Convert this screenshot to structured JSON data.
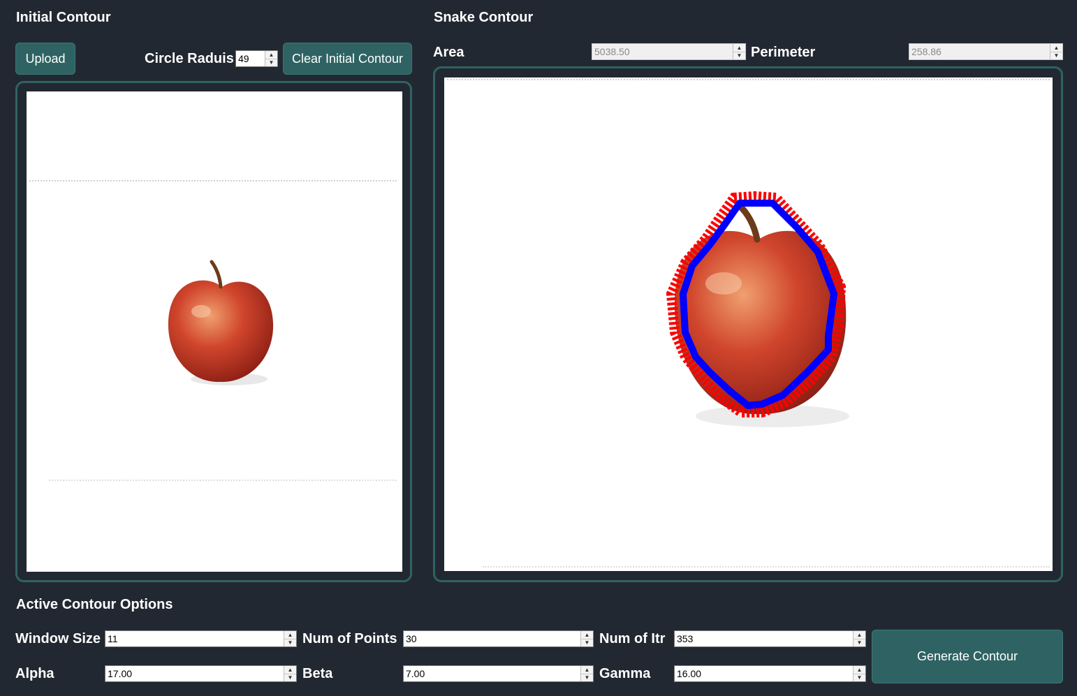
{
  "left": {
    "title": "Initial Contour",
    "upload_label": "Upload",
    "radius_label": "Circle Raduis",
    "radius_value": "49",
    "clear_label": "Clear Initial Contour"
  },
  "right": {
    "title": "Snake Contour",
    "area_label": "Area",
    "area_value": "5038.50",
    "perimeter_label": "Perimeter",
    "perimeter_value": "258.86"
  },
  "options": {
    "title": "Active Contour Options",
    "window_size_label": "Window Size",
    "window_size_value": "11",
    "num_points_label": "Num of Points",
    "num_points_value": "30",
    "num_itr_label": "Num of Itr",
    "num_itr_value": "353",
    "alpha_label": "Alpha",
    "alpha_value": "17.00",
    "beta_label": "Beta",
    "beta_value": "7.00",
    "gamma_label": "Gamma",
    "gamma_value": "16.00",
    "generate_label": "Generate Contour"
  },
  "colors": {
    "background": "#222831",
    "accent": "#2f6363",
    "snake_outer": "#ff0000",
    "snake_inner": "#0000ff",
    "apple": "#c0392b"
  },
  "icons": {
    "spin_up": "up-arrow-icon",
    "spin_down": "down-arrow-icon"
  }
}
